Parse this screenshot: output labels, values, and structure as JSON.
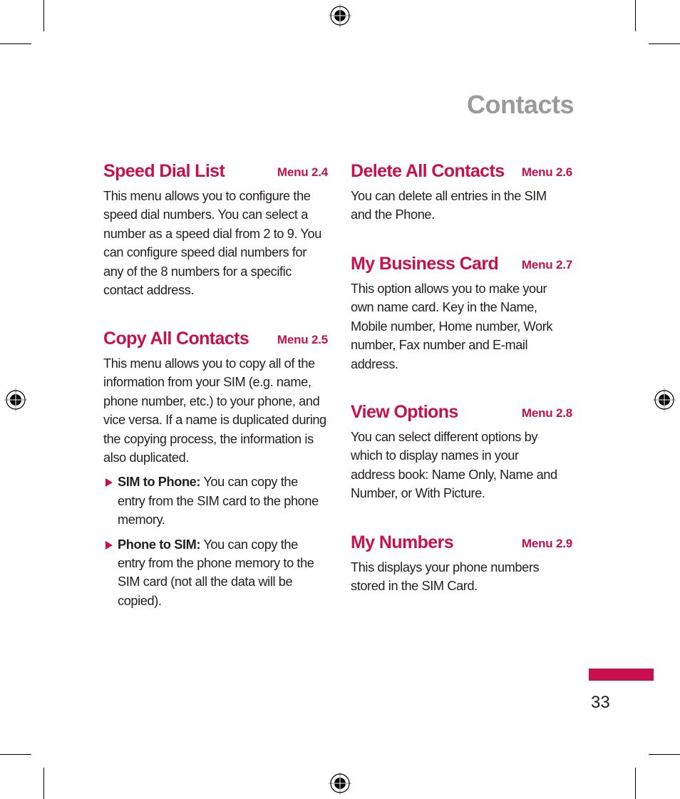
{
  "page": {
    "title": "Contacts",
    "page_number": "33",
    "accent_color": "#c8104f",
    "title_color": "#9a9a9c"
  },
  "left_column": {
    "sections": [
      {
        "heading": "Speed Dial List",
        "menu": "Menu 2.4",
        "body": "This menu allows you to configure the speed dial numbers. You can select a number as a speed dial from 2 to 9. You can configure speed dial numbers for any of the 8 numbers for a specific contact address."
      },
      {
        "heading": "Copy All Contacts",
        "menu": "Menu 2.5",
        "body": "This menu allows you to copy all of the information from your SIM (e.g. name, phone number, etc.) to your phone, and vice versa. If a name is duplicated during the copying process, the information is also duplicated.",
        "bullets": [
          {
            "label": "SIM to Phone:",
            "text": " You can copy the entry from the SIM card to the phone memory."
          },
          {
            "label": "Phone to SIM:",
            "text": " You can copy the entry from the phone memory to the SIM card (not all the data will be copied)."
          }
        ]
      }
    ]
  },
  "right_column": {
    "sections": [
      {
        "heading": "Delete All Contacts",
        "menu": "Menu 2.6",
        "body": "You can delete all entries in the SIM and the Phone."
      },
      {
        "heading": "My Business Card",
        "menu": "Menu 2.7",
        "body": "This option allows you to make your own name card. Key in the Name, Mobile number, Home number, Work number, Fax number and E-mail address."
      },
      {
        "heading": "View Options",
        "menu": "Menu 2.8",
        "body": "You can select different options by which to display names in your address book: Name Only, Name and Number, or With Picture."
      },
      {
        "heading": "My Numbers",
        "menu": "Menu 2.9",
        "body": "This displays your phone numbers stored in the SIM Card."
      }
    ]
  }
}
